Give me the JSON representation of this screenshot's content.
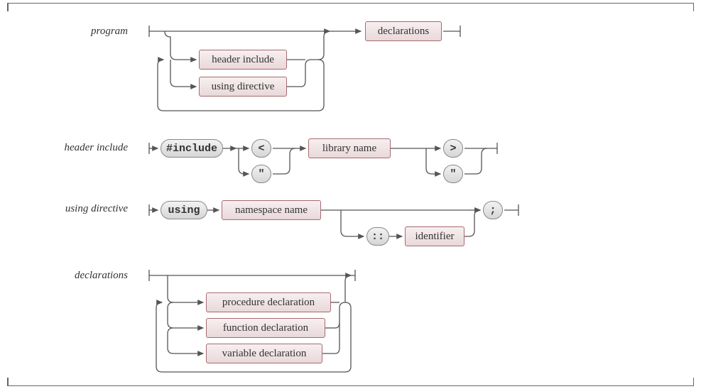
{
  "rules": {
    "program": {
      "label": "program",
      "alts": {
        "a1": "header include",
        "a2": "using directive"
      },
      "tail": "declarations"
    },
    "header_include": {
      "label": "header include",
      "kw": "#include",
      "lt": "<",
      "q1": "\"",
      "lib": "library name",
      "gt": ">",
      "q2": "\""
    },
    "using_directive": {
      "label": "using directive",
      "kw": "using",
      "ns": "namespace name",
      "cc": "::",
      "id": "identifier",
      "semi": ";"
    },
    "declarations": {
      "label": "declarations",
      "alts": {
        "a1": "procedure declaration",
        "a2": "function declaration",
        "a3": "variable declaration"
      }
    }
  }
}
